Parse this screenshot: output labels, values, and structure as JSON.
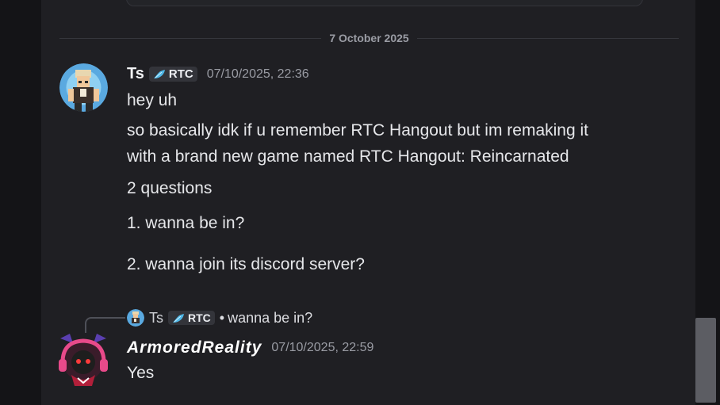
{
  "date_divider": "7 October 2025",
  "messages": [
    {
      "author": "Ts",
      "tag": "RTC",
      "timestamp": "07/10/2025, 22:36",
      "lines": [
        "hey uh",
        "so basically idk if u remember RTC Hangout but im remaking it",
        "with a brand new game named RTC Hangout: Reincarnated",
        "2 questions",
        "1. wanna be in?",
        "2. wanna join its discord server?"
      ]
    },
    {
      "author": "ArmoredReality",
      "timestamp": "07/10/2025, 22:59",
      "reply": {
        "author": "Ts",
        "tag": "RTC",
        "separator": "•",
        "text": "wanna be in?"
      },
      "lines": [
        "Yes"
      ]
    }
  ],
  "colors": {
    "tag_icon": "#4fb8e8",
    "background": "#1f1f23"
  },
  "icons": {
    "tag_icon": "blue-feather-icon"
  }
}
